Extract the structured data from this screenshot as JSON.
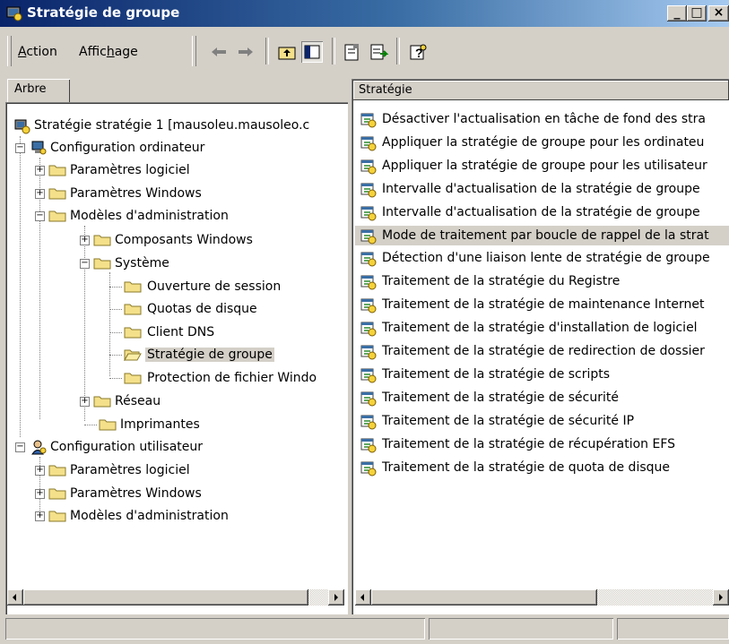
{
  "window": {
    "title": "Stratégie de groupe"
  },
  "titlebar_buttons": {
    "minimize": "_",
    "maximize": "□",
    "close": "×"
  },
  "menu": {
    "action": "Action",
    "view": "Affichage"
  },
  "toolbar": [
    "back-icon",
    "forward-icon",
    "up-folder-icon",
    "show-tree-icon",
    "properties-icon",
    "export-list-icon",
    "help-icon"
  ],
  "left_tab": {
    "label": "Arbre"
  },
  "tree": {
    "root": "Stratégie stratégie 1 [mausoleu.mausoleo.c",
    "computer_config": "Configuration ordinateur",
    "cc_software": "Paramètres logiciel",
    "cc_windows": "Paramètres Windows",
    "cc_admin": "Modèles d'administration",
    "cc_admin_components": "Composants Windows",
    "cc_admin_system": "Système",
    "sys_logon": "Ouverture de session",
    "sys_quota": "Quotas de disque",
    "sys_dns": "Client DNS",
    "sys_gp": "Stratégie de groupe",
    "sys_wfp": "Protection de fichier Windo",
    "cc_admin_network": "Réseau",
    "cc_admin_printers": "Imprimantes",
    "user_config": "Configuration utilisateur",
    "uc_software": "Paramètres logiciel",
    "uc_windows": "Paramètres Windows",
    "uc_admin": "Modèles d'administration"
  },
  "list": {
    "header": "Stratégie",
    "items": [
      "Désactiver l'actualisation en tâche de fond des stra",
      "Appliquer la stratégie de groupe pour les ordinateu",
      "Appliquer la stratégie de groupe pour les utilisateur",
      "Intervalle d'actualisation de la stratégie de groupe",
      "Intervalle d'actualisation de la stratégie de groupe",
      "Mode de traitement par boucle de rappel de la strat",
      "Détection d'une liaison lente de stratégie de groupe",
      "Traitement de la stratégie du Registre",
      "Traitement de la stratégie de maintenance Internet",
      "Traitement de la stratégie d'installation de logiciel",
      "Traitement de la stratégie de redirection de dossier",
      "Traitement de la stratégie de scripts",
      "Traitement de la stratégie de sécurité",
      "Traitement de la stratégie de sécurité IP",
      "Traitement de la stratégie de récupération EFS",
      "Traitement de la stratégie de quota de disque"
    ]
  },
  "colors": {
    "title_start": "#0a246a",
    "title_end": "#a6caf0",
    "face": "#d4d0c8"
  }
}
